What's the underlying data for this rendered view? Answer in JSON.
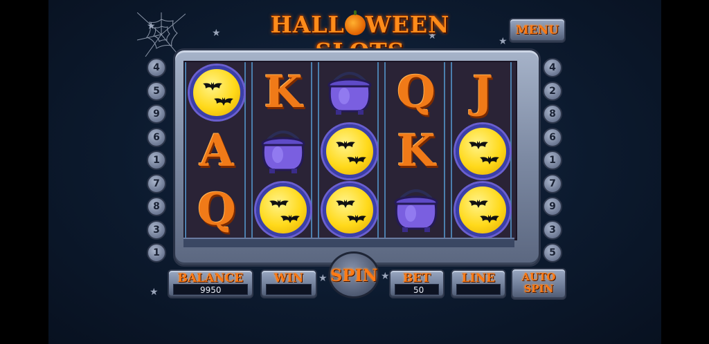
{
  "title": "HALL",
  "title_rest": "WEEN SLOTS",
  "menu_label": "MENU",
  "left_numbers": [
    "4",
    "5",
    "9",
    "6",
    "1",
    "7",
    "8",
    "3",
    "1"
  ],
  "right_numbers": [
    "4",
    "2",
    "8",
    "6",
    "1",
    "7",
    "9",
    "3",
    "5"
  ],
  "reels": [
    [
      "moon",
      "letter-A",
      "letter-Q"
    ],
    [
      "letter-K",
      "cauldron",
      "moon"
    ],
    [
      "cauldron",
      "moon",
      "moon"
    ],
    [
      "letter-Q",
      "letter-K",
      "cauldron"
    ],
    [
      "letter-J",
      "moon",
      "moon"
    ]
  ],
  "letters": {
    "A": "A",
    "K": "K",
    "Q": "Q",
    "J": "J"
  },
  "balance": {
    "label": "BALANCE",
    "value": "9950"
  },
  "win": {
    "label": "WIN",
    "value": ""
  },
  "spin_label": "SPIN",
  "bet": {
    "label": "BET",
    "value": "50"
  },
  "line": {
    "label": "LINE",
    "value": ""
  },
  "auto_spin": {
    "label_line1": "AUTO",
    "label_line2": "SPIN"
  },
  "colors": {
    "accent": "#ff7a14",
    "background": "#0a1628",
    "reel_divider": "#4b7fae"
  }
}
